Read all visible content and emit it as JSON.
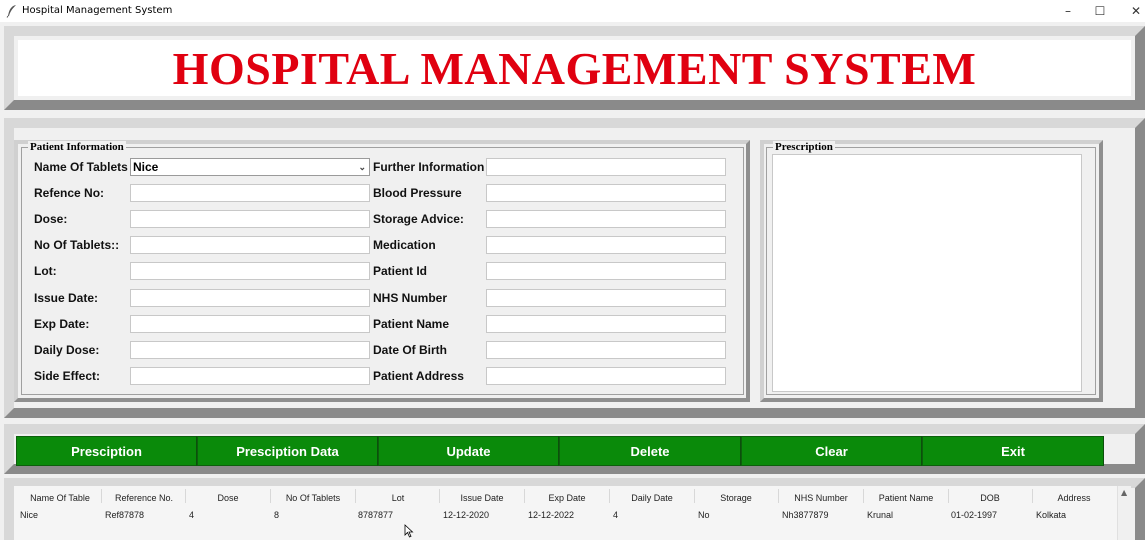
{
  "window": {
    "title": "Hospital Management System",
    "minimize": "–",
    "maximize": "☐",
    "close": "✕"
  },
  "banner": {
    "title": "HOSPITAL MANAGEMENT SYSTEM",
    "color": "#e00010"
  },
  "patient_info": {
    "legend": "Patient Information",
    "left": [
      {
        "label": "Name Of Tablets",
        "value": "Nice"
      },
      {
        "label": "Refence No:",
        "value": ""
      },
      {
        "label": "Dose:",
        "value": ""
      },
      {
        "label": "No Of Tablets::",
        "value": ""
      },
      {
        "label": "Lot:",
        "value": ""
      },
      {
        "label": "Issue Date:",
        "value": ""
      },
      {
        "label": "Exp Date:",
        "value": ""
      },
      {
        "label": "Daily Dose:",
        "value": ""
      },
      {
        "label": "Side Effect:",
        "value": ""
      }
    ],
    "right": [
      {
        "label": "Further Information",
        "value": ""
      },
      {
        "label": "Blood Pressure",
        "value": ""
      },
      {
        "label": "Storage Advice:",
        "value": ""
      },
      {
        "label": "Medication",
        "value": ""
      },
      {
        "label": "Patient Id",
        "value": ""
      },
      {
        "label": "NHS Number",
        "value": ""
      },
      {
        "label": "Patient Name",
        "value": ""
      },
      {
        "label": "Date Of Birth",
        "value": ""
      },
      {
        "label": "Patient Address",
        "value": ""
      }
    ]
  },
  "prescription": {
    "legend": "Prescription",
    "text": ""
  },
  "buttons": [
    "Presciption",
    "Presciption Data",
    "Update",
    "Delete",
    "Clear",
    "Exit"
  ],
  "button_color": "#0a8a0a",
  "table": {
    "columns": [
      "Name Of Table",
      "Reference No.",
      "Dose",
      "No Of Tablets",
      "Lot",
      "Issue Date",
      "Exp Date",
      "Daily Date",
      "Storage",
      "NHS Number",
      "Patient Name",
      "DOB",
      "Address"
    ],
    "rows": [
      [
        "Nice",
        "Ref87878",
        "4",
        "8",
        "8787877",
        "12-12-2020",
        "12-12-2022",
        "4",
        "No",
        "Nh3877879",
        "Krunal",
        "01-02-1997",
        "Kolkata"
      ]
    ]
  }
}
